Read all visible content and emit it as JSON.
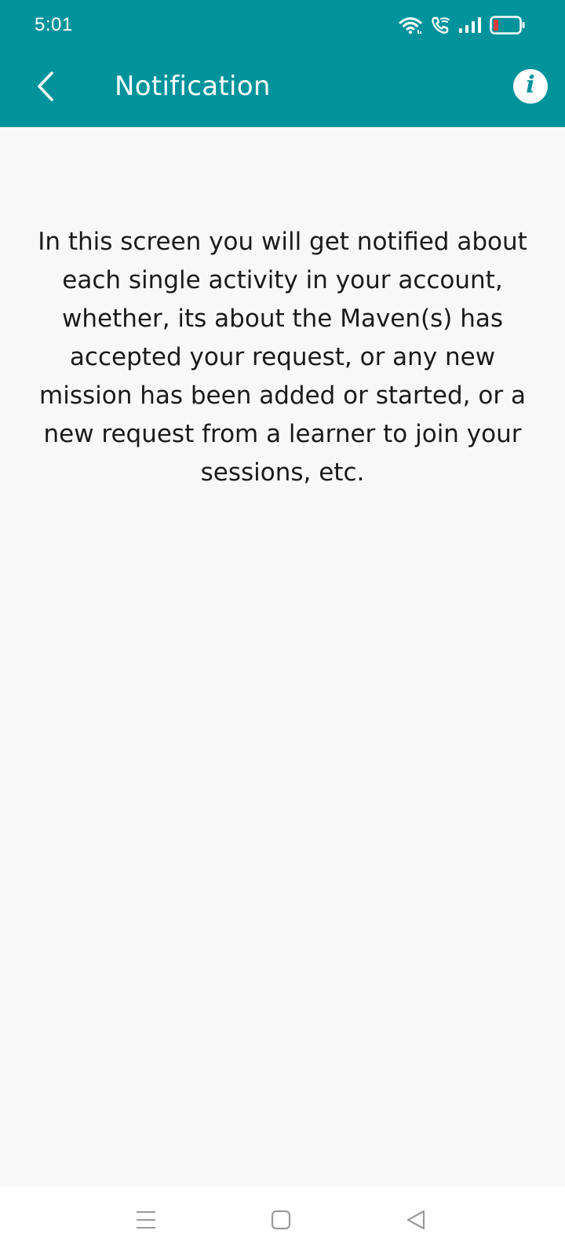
{
  "status_bar": {
    "time": "5:01",
    "icons": [
      "wifi-icon",
      "wifi-call-icon",
      "signal-icon",
      "battery-low-icon"
    ]
  },
  "app_bar": {
    "title": "Notification",
    "back_icon": "chevron-left-icon",
    "info_icon": "info-icon",
    "background_color": "#00939b"
  },
  "main": {
    "message": "In this screen you will get notified about each single activity in your account, whether, its about the Maven(s) has accepted your request, or any new mission has been added or started, or a new request from a learner to join your sessions, etc."
  },
  "nav_bar": {
    "icons": [
      "menu-icon",
      "home-icon",
      "back-triangle-icon"
    ]
  }
}
